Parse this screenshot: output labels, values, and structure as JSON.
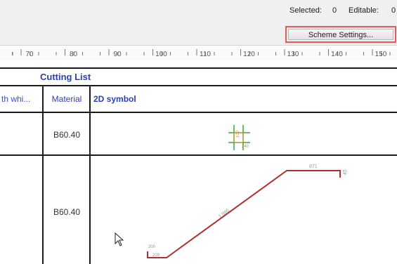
{
  "status": {
    "selected_label": "Selected:",
    "selected_value": "0",
    "editable_label": "Editable:",
    "editable_value": "0"
  },
  "toolbar": {
    "scheme_button": "Scheme Settings..."
  },
  "ruler": {
    "ticks": [
      "70",
      "80",
      "90",
      "100",
      "110",
      "120",
      "130",
      "140",
      "150"
    ]
  },
  "table": {
    "title": "Cutting List",
    "columns": [
      "th whi...",
      "Material",
      "2D symbol"
    ],
    "rows": [
      {
        "material": "B60.40",
        "symbol_labels": [
          "100",
          "240"
        ]
      },
      {
        "material": "B60.40",
        "symbol_labels": [
          "871",
          "45",
          "1 985",
          "300",
          "209"
        ]
      }
    ]
  },
  "colors": {
    "header_text": "#2b3fb8",
    "highlight": "#e85a5a",
    "profile": "#b03030",
    "cross": "#3aa64a"
  },
  "icons": {
    "pointer": "mouse-pointer-icon"
  }
}
